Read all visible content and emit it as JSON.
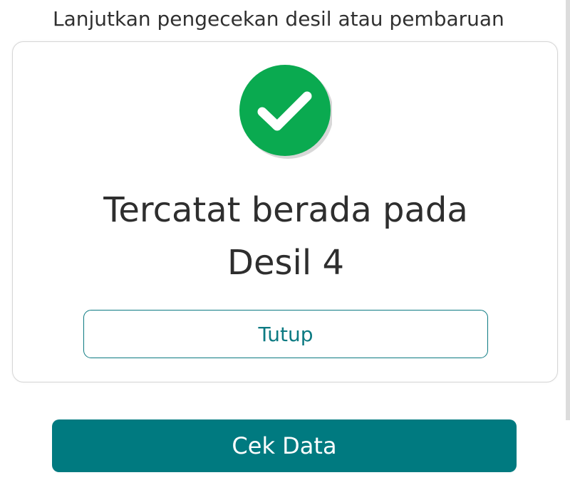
{
  "background": {
    "instruction_text": "Lanjutkan pengecekan desil atau pembaruan data"
  },
  "dialog": {
    "icon": "check-circle-icon",
    "title_line1": "Tercatat berada pada",
    "title_line2": "Desil 4",
    "close_label": "Tutup"
  },
  "footer": {
    "primary_button_label": "Cek Data"
  },
  "colors": {
    "accent": "#007a80",
    "success": "#0aaa50",
    "text": "#2e2e2e"
  }
}
